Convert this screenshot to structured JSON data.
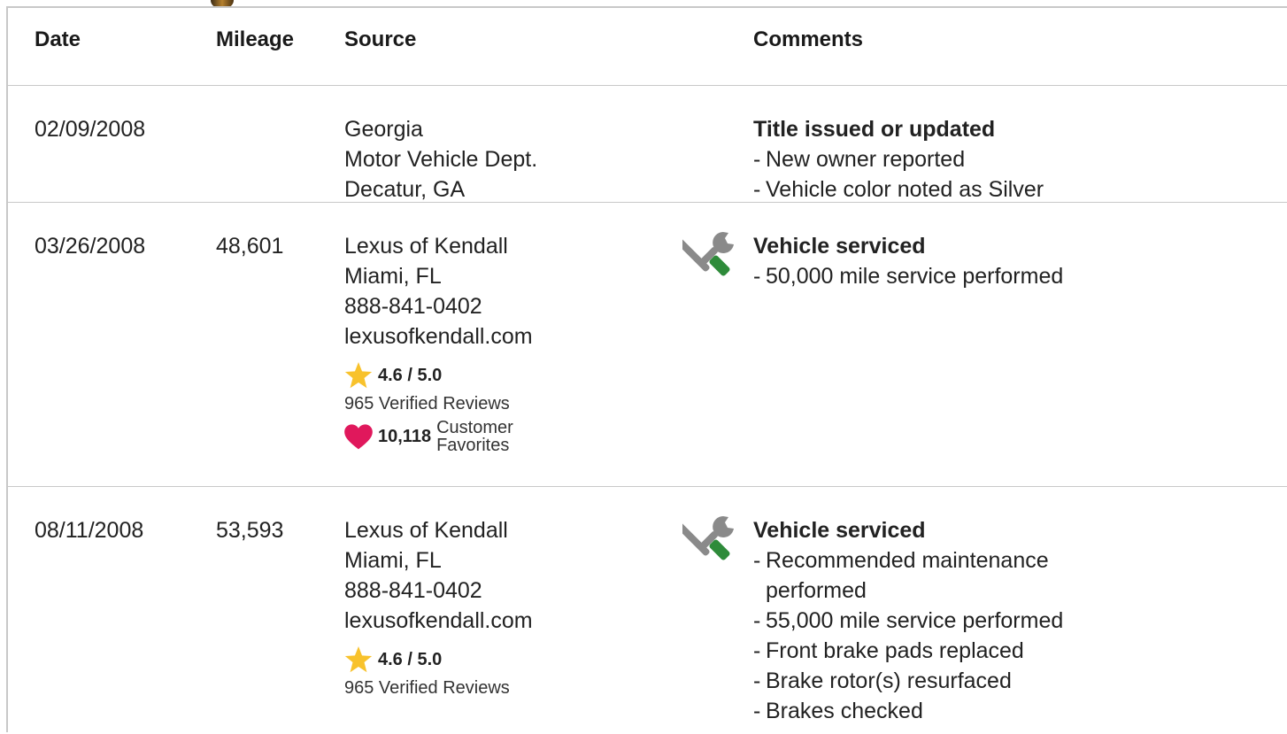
{
  "columns": {
    "date": "Date",
    "mileage": "Mileage",
    "source": "Source",
    "comments": "Comments"
  },
  "records": [
    {
      "date": "02/09/2008",
      "mileage": "",
      "source": [
        "Georgia",
        "Motor Vehicle Dept.",
        "Decatur, GA"
      ],
      "comment_title": "Title issued or updated",
      "comment_items": [
        "New owner reported",
        "Vehicle color noted as Silver"
      ]
    },
    {
      "date": "03/26/2008",
      "mileage": "48,601",
      "icon": "service-tools-icon",
      "source": [
        "Lexus of Kendall",
        "Miami, FL",
        "888-841-0402",
        "lexusofkendall.com"
      ],
      "rating": "4.6 / 5.0",
      "reviews": "965 Verified Reviews",
      "favorites_count": "10,118",
      "favorites_label": "Customer Favorites",
      "comment_title": "Vehicle serviced",
      "comment_items": [
        "50,000 mile service performed"
      ]
    },
    {
      "date": "08/11/2008",
      "mileage": "53,593",
      "icon": "service-tools-icon",
      "source": [
        "Lexus of Kendall",
        "Miami, FL",
        "888-841-0402",
        "lexusofkendall.com"
      ],
      "rating": "4.6 / 5.0",
      "reviews": "965 Verified Reviews",
      "comment_title": "Vehicle serviced",
      "comment_items": [
        "Recommended maintenance",
        "performed",
        "55,000 mile service performed",
        "Front brake pads replaced",
        "Brake rotor(s) resurfaced",
        "Brakes checked"
      ]
    }
  ],
  "colors": {
    "star": "#F8C22C",
    "heart": "#E0185C",
    "tool_gray": "#8A8A8A",
    "tool_green": "#2E8B3A",
    "border": "#C8C8C8"
  }
}
